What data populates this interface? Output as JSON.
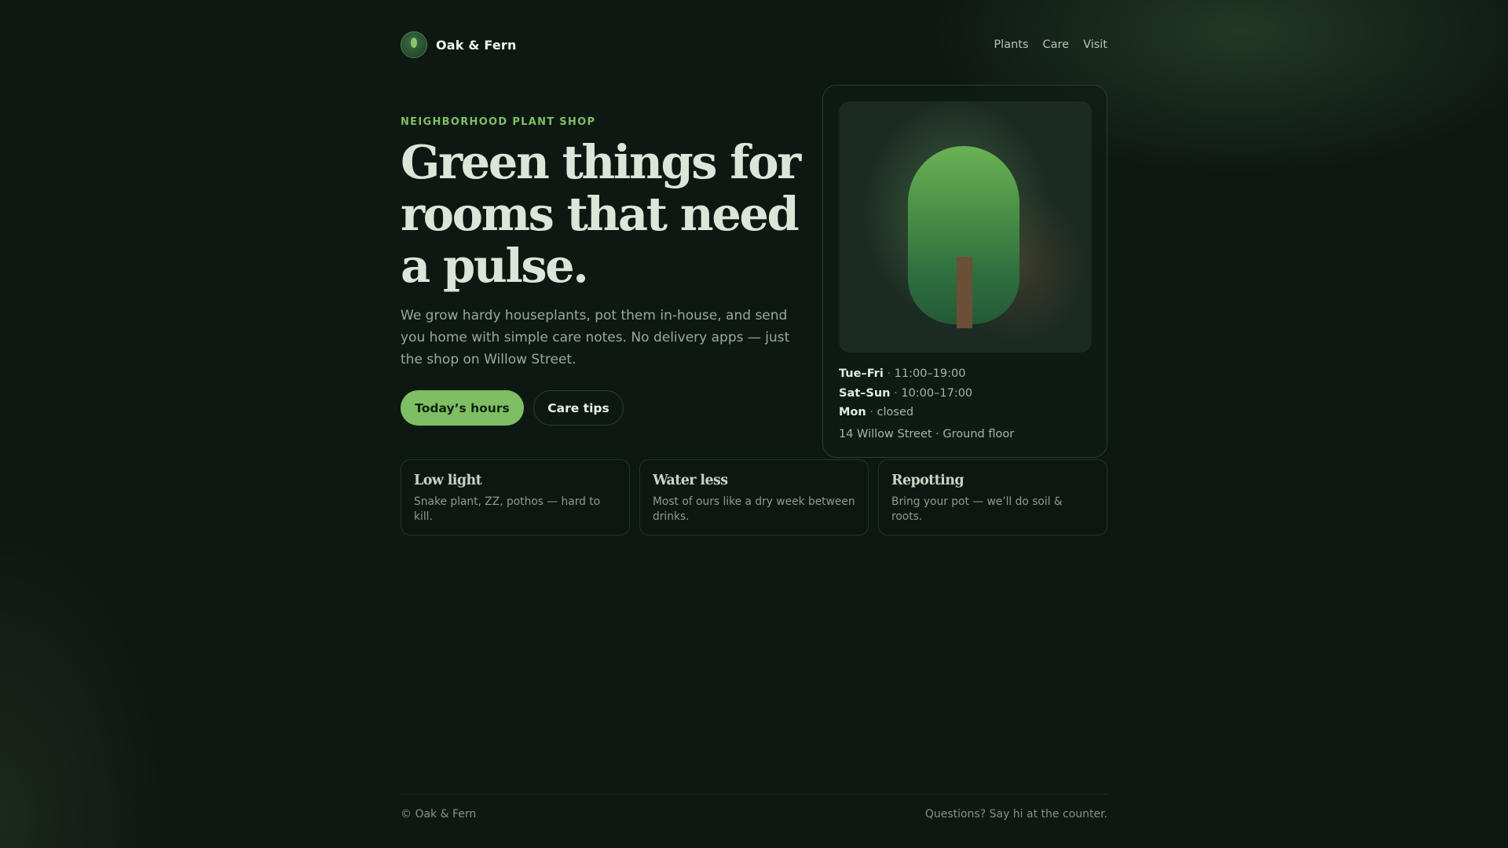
{
  "brand": {
    "name": "Oak & Fern",
    "logo_icon": "leaf-icon"
  },
  "nav": {
    "items": [
      "Plants",
      "Care",
      "Visit"
    ]
  },
  "hero": {
    "eyebrow": "NEIGHBORHOOD PLANT SHOP",
    "headline": "Green things for rooms that need a pulse.",
    "lede": "We grow hardy houseplants, pot them in-house, and send you home with simple care notes. No delivery apps — just the shop on Willow Street.",
    "primary_button": "Today’s hours",
    "secondary_button": "Care tips"
  },
  "hours_card": {
    "illustration_icon": "tree-icon",
    "separator": "·",
    "rows": [
      {
        "day": "Tue–Fri",
        "time": "11:00–19:00"
      },
      {
        "day": "Sat–Sun",
        "time": "10:00–17:00"
      },
      {
        "day": "Mon",
        "time": "closed"
      }
    ],
    "address": "14 Willow Street · Ground floor"
  },
  "features": [
    {
      "title": "Low light",
      "text": "Snake plant, ZZ, pothos — hard to kill."
    },
    {
      "title": "Water less",
      "text": "Most of ours like a dry week between drinks."
    },
    {
      "title": "Repotting",
      "text": "Bring your pot — we’ll do soil & roots."
    }
  ],
  "footer": {
    "copyright": "© Oak & Fern",
    "note": "Questions? Say hi at the counter."
  },
  "colors": {
    "background": "#0e1813",
    "accent": "#7dbf62",
    "eyebrow": "#7fbf66",
    "headline": "#dbe6d8",
    "muted_text": "#9aa998"
  }
}
